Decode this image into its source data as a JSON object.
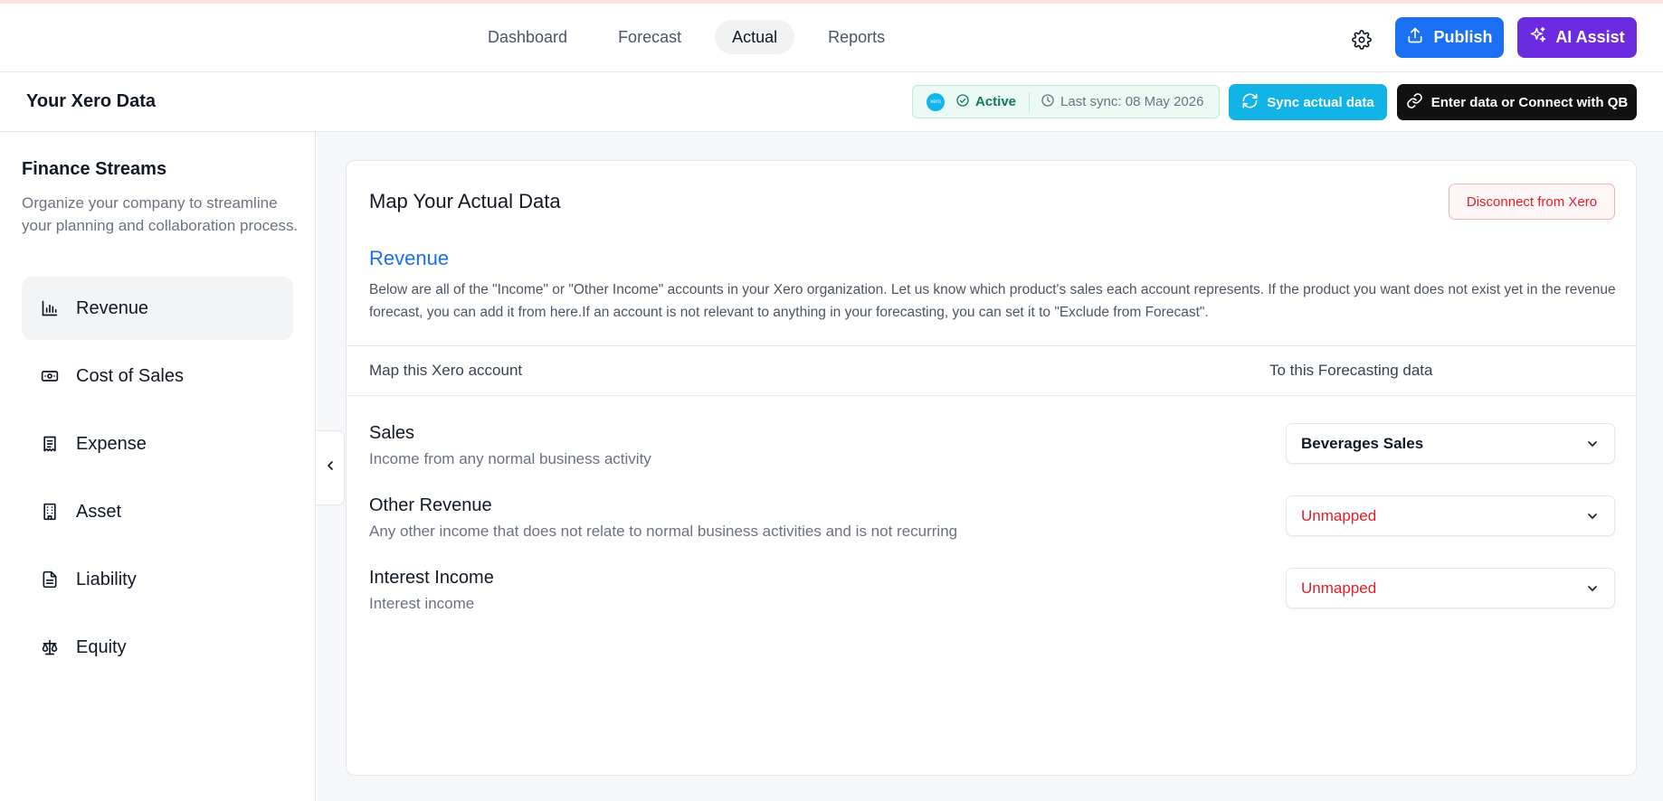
{
  "nav": {
    "tabs": [
      {
        "label": "Dashboard"
      },
      {
        "label": "Forecast"
      },
      {
        "label": "Actual"
      },
      {
        "label": "Reports"
      }
    ],
    "publish_label": "Publish",
    "ai_label": "AI Assist"
  },
  "header": {
    "title": "Your Xero Data",
    "xero_logo_text": "xero",
    "status": "Active",
    "last_sync": "Last sync: 08 May 2026",
    "sync_label": "Sync actual data",
    "connect_label": "Enter data or Connect with QB"
  },
  "sidebar": {
    "title": "Finance Streams",
    "description": "Organize your company to streamline your planning and collaboration process.",
    "items": [
      {
        "label": "Revenue",
        "icon": "bar-chart-icon"
      },
      {
        "label": "Cost of Sales",
        "icon": "banknote-icon"
      },
      {
        "label": "Expense",
        "icon": "receipt-icon"
      },
      {
        "label": "Asset",
        "icon": "building-icon"
      },
      {
        "label": "Liability",
        "icon": "document-icon"
      },
      {
        "label": "Equity",
        "icon": "scale-icon"
      }
    ]
  },
  "main": {
    "card_title": "Map Your Actual Data",
    "disconnect_label": "Disconnect from Xero",
    "section_title": "Revenue",
    "section_desc": "Below are all of the \"Income\" or \"Other Income\" accounts in your Xero organization. Let us know which product's sales each account represents. If the product you want does not exist yet in the revenue forecast, you can add it from here.If an account is not relevant to anything in your forecasting, you can set it to \"Exclude from Forecast\".",
    "col_left": "Map this Xero account",
    "col_right": "To this Forecasting data",
    "rows": [
      {
        "name": "Sales",
        "desc": "Income from any normal business activity",
        "mapping": "Beverages Sales"
      },
      {
        "name": "Other Revenue",
        "desc": "Any other income that does not relate to normal business activities and is not recurring",
        "mapping": "Unmapped"
      },
      {
        "name": "Interest Income",
        "desc": "Interest income",
        "mapping": "Unmapped"
      }
    ]
  },
  "colors": {
    "primary": "#1a6ff3",
    "ai": "#6c2be0",
    "sync": "#12b4e8",
    "danger": "#e11d2a",
    "active_green": "#0f7a56"
  }
}
